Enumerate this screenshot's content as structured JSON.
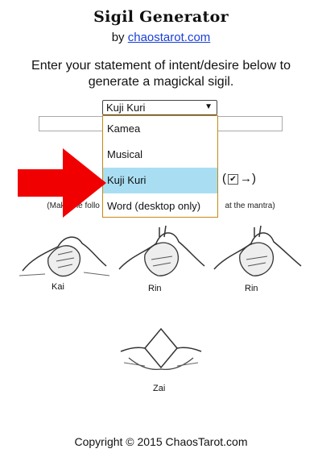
{
  "header": {
    "title": "Sigil Generator",
    "by_prefix": "by",
    "by_link": "chaostarot.com"
  },
  "instructions": "Enter your statement of intent/desire below to generate a magickal sigil.",
  "mode_select": {
    "selected": "Kuji Kuri",
    "options": [
      "Kamea",
      "Musical",
      "Kuji Kuri",
      "Word (desktop only)"
    ],
    "highlighted_index": 2
  },
  "options_row": {
    "checkbox_checked": true,
    "arrow_text": "→)"
  },
  "note": {
    "left": "(Make the follo",
    "right": "at the mantra)"
  },
  "hands": [
    {
      "label": "Kai"
    },
    {
      "label": "Rin"
    },
    {
      "label": "Rin"
    },
    {
      "label": "Zai"
    }
  ],
  "colors": {
    "arrow": "#f00000",
    "highlight": "#a9def2",
    "dropdown_border": "#c58a12",
    "link": "#1a3fd6"
  },
  "footer": {
    "copyright": "Copyright © 2015 ChaosTarot.com"
  }
}
